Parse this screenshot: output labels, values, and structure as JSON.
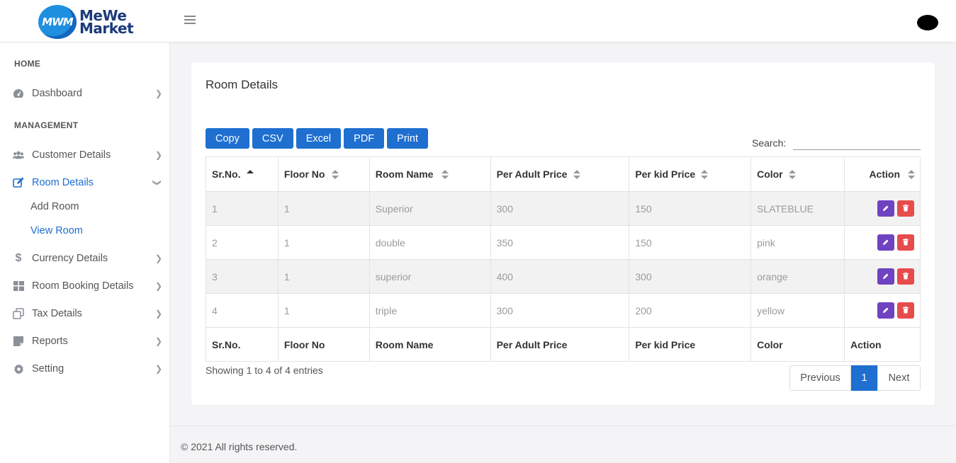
{
  "header": {
    "logo_mark": "MWM",
    "logo_line1": "MeWe",
    "logo_line2": "Market",
    "menu_icon": "hamburger-icon",
    "avatar": "user-avatar"
  },
  "sidebar": {
    "heading_home": "HOME",
    "heading_management": "MANAGEMENT",
    "items": [
      {
        "label": "Dashboard",
        "icon": "dashboard-icon"
      },
      {
        "label": "Customer Details",
        "icon": "users-icon"
      },
      {
        "label": "Room Details",
        "icon": "edit-icon"
      },
      {
        "label": "Currency Details",
        "icon": "dollar-icon"
      },
      {
        "label": "Room Booking Details",
        "icon": "grid-icon"
      },
      {
        "label": "Tax Details",
        "icon": "copy-icon"
      },
      {
        "label": "Reports",
        "icon": "note-icon"
      },
      {
        "label": "Setting",
        "icon": "gear-icon"
      }
    ],
    "sub_items": [
      "Add Room",
      "View Room"
    ]
  },
  "card": {
    "title": "Room Details",
    "buttons": [
      "Copy",
      "CSV",
      "Excel",
      "PDF",
      "Print"
    ],
    "search_label": "Search:",
    "search_value": ""
  },
  "table": {
    "columns": [
      "Sr.No.",
      "Floor No",
      "Room Name",
      "Per Adult Price",
      "Per kid Price",
      "Color",
      "Action"
    ],
    "rows": [
      [
        "1",
        "1",
        "Superior",
        "300",
        "150",
        "SLATEBLUE"
      ],
      [
        "2",
        "1",
        "double",
        "350",
        "150",
        "pink"
      ],
      [
        "3",
        "1",
        "superior",
        "400",
        "300",
        "orange"
      ],
      [
        "4",
        "1",
        "triple",
        "300",
        "200",
        "yellow"
      ]
    ]
  },
  "pagination": {
    "info": "Showing 1 to 4 of 4 entries",
    "previous": "Previous",
    "current": "1",
    "next": "Next"
  },
  "footer": {
    "text": "© 2021 All rights reserved."
  },
  "colors": {
    "accent": "#1e6fd0",
    "edit": "#6f42c1",
    "delete": "#e74c4c"
  }
}
